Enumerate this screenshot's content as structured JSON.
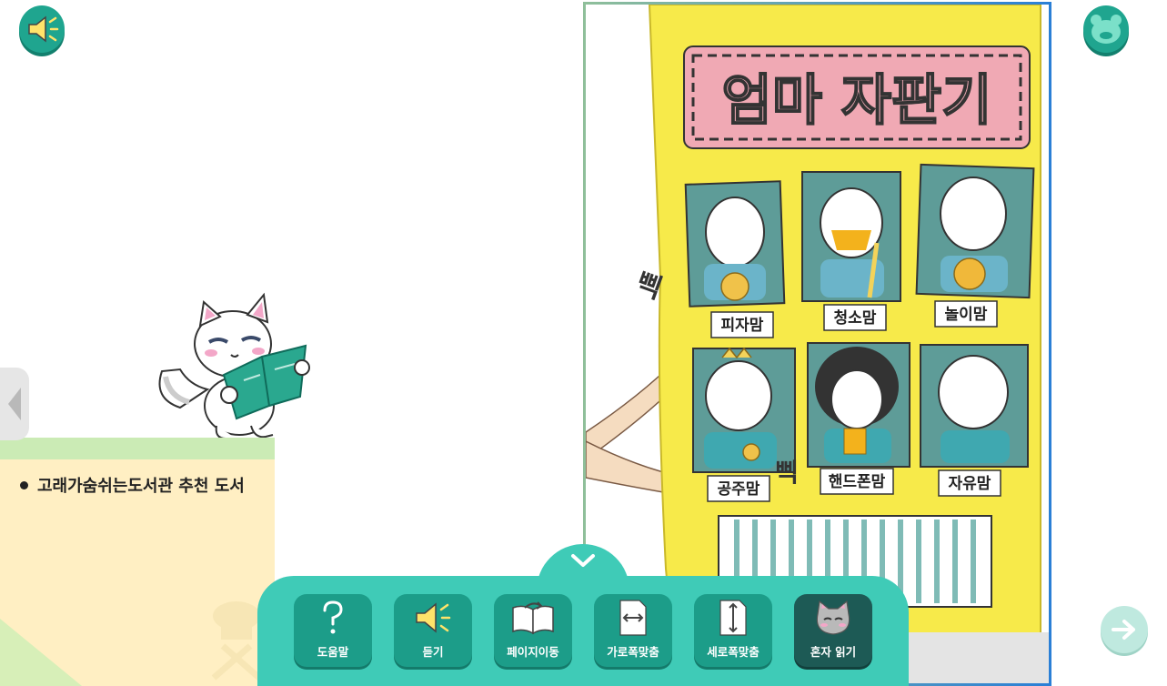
{
  "top_left": {
    "icon": "speaker-icon"
  },
  "top_right": {
    "icon": "face-icon"
  },
  "left_page": {
    "recommendation": "고래가숨쉬는도서관 추천 도서"
  },
  "illustration": {
    "sign_title": "엄마 자판기",
    "sound_effect": "삑",
    "sound_effect_2": "삑",
    "moms": [
      "피자맘",
      "청소맘",
      "놀이맘",
      "공주맘",
      "핸드폰맘",
      "자유맘"
    ]
  },
  "toolbar": {
    "buttons": [
      {
        "label": "도움말",
        "icon": "question-icon"
      },
      {
        "label": "듣기",
        "icon": "speaker-icon"
      },
      {
        "label": "페이지이동",
        "icon": "book-flip-icon"
      },
      {
        "label": "가로폭맞춤",
        "icon": "fit-width-icon"
      },
      {
        "label": "세로폭맞춤",
        "icon": "fit-height-icon"
      },
      {
        "label": "혼자 읽기",
        "icon": "cat-icon"
      }
    ]
  },
  "colors": {
    "primary": "#1fa58f",
    "toolbar": "#3fcbb7",
    "vending_yellow": "#f7ea4a",
    "sign_pink": "#f0a9b4",
    "window_teal": "#5e9c98"
  }
}
